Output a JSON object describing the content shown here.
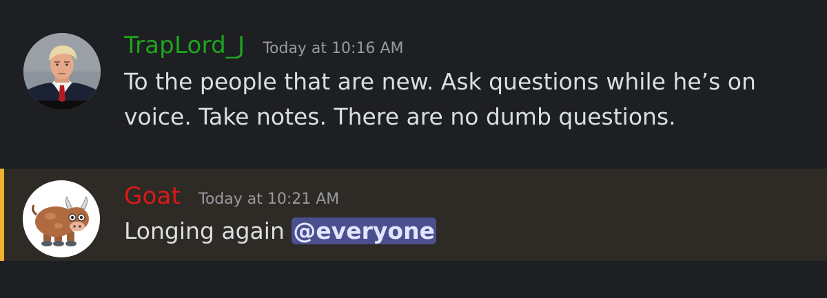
{
  "messages": [
    {
      "username": "TrapLord_J",
      "timestamp": "Today at 10:16 AM",
      "content_line1": "To the people that are new. Ask questions while he’s on",
      "content_line2": "voice. Take notes. There are no dumb questions.",
      "username_color": "#1da61d",
      "avatar_icon": "portrait-avatar"
    },
    {
      "username": "Goat",
      "timestamp": "Today at 10:21 AM",
      "content": "Longing again",
      "mention": "@everyone",
      "username_color": "#d91a1a",
      "avatar_icon": "bull-cartoon-avatar",
      "highlighted": true,
      "highlight_bar_color": "#f0b232"
    }
  ],
  "colors": {
    "background": "#1e1f22",
    "highlight_background": "#2e2a25",
    "mention_background": "#4c4f8e",
    "text": "#dbdee1",
    "timestamp": "#989aa1"
  }
}
